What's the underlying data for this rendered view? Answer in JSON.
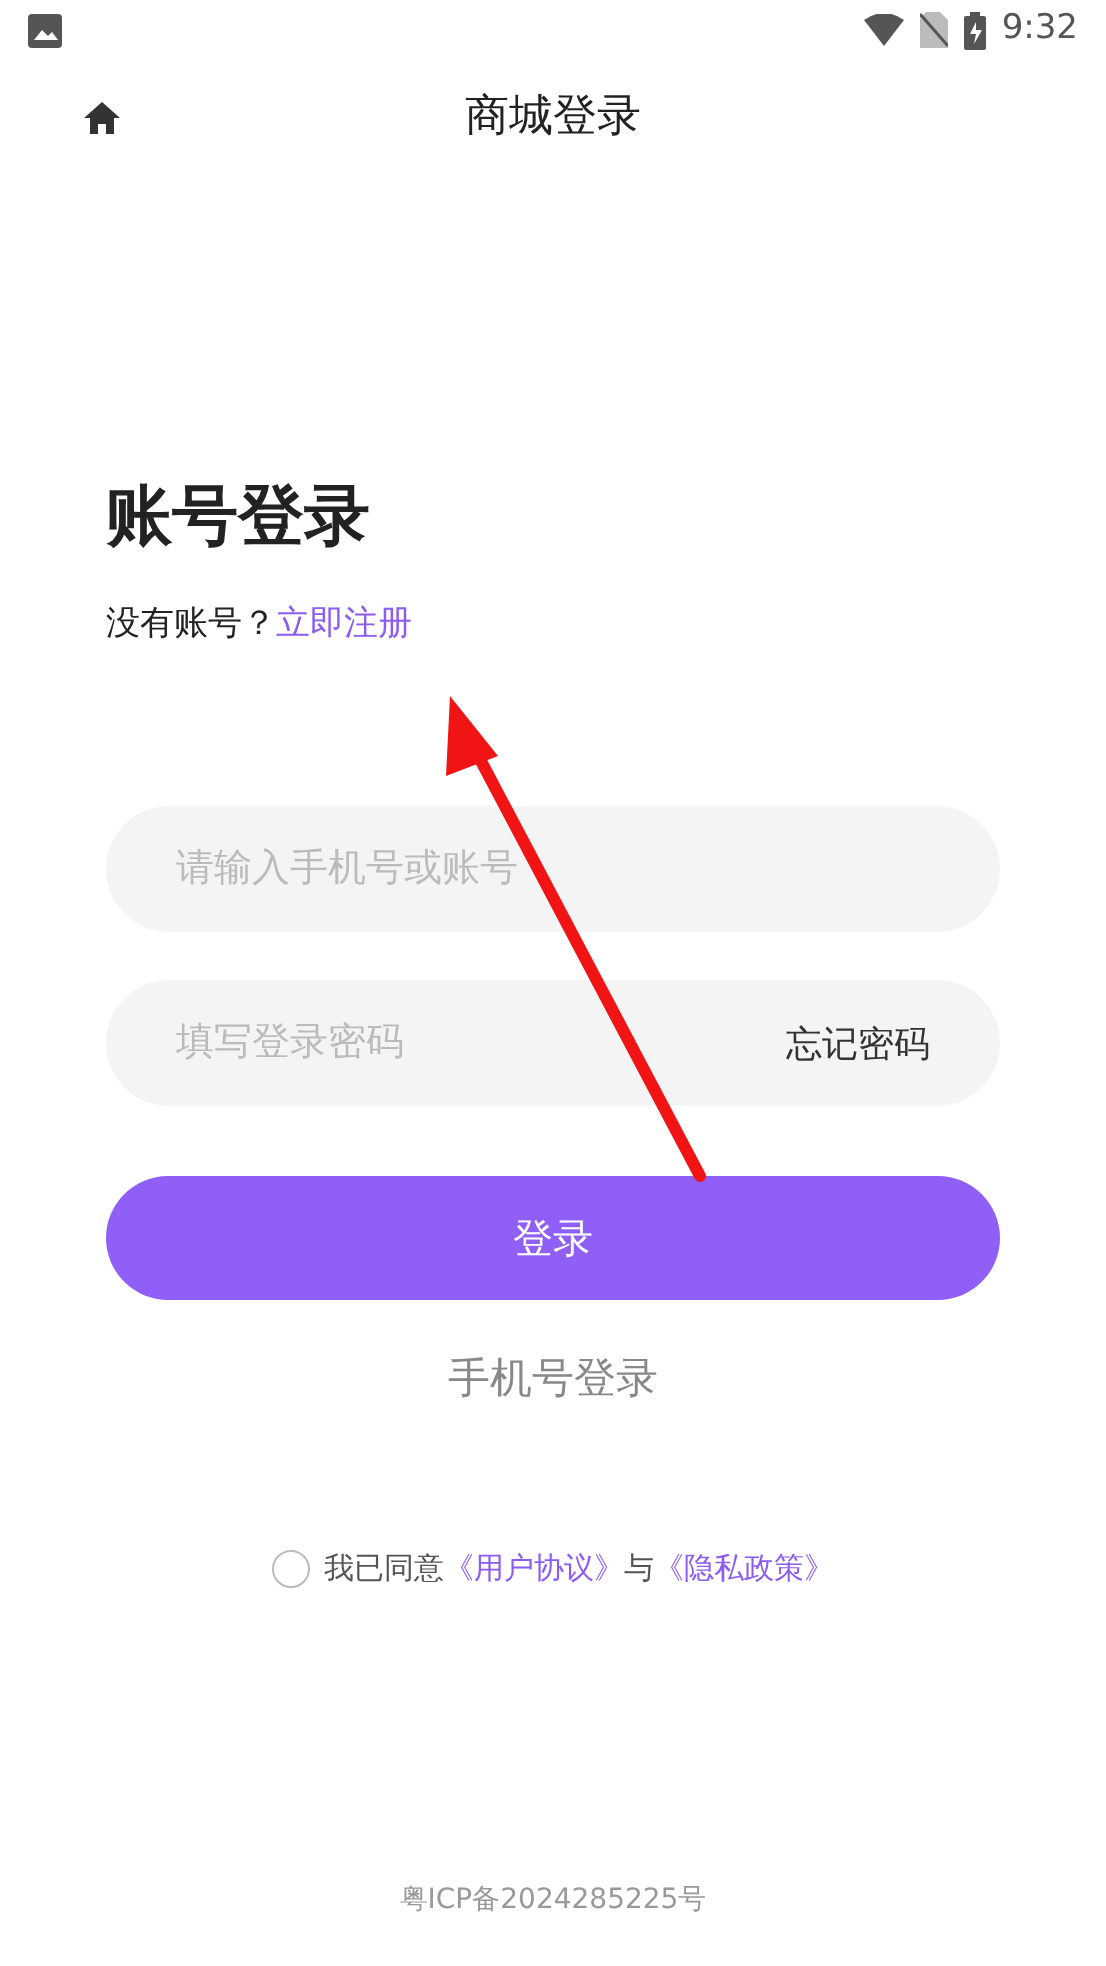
{
  "status_bar": {
    "time": "9:32"
  },
  "header": {
    "title": "商城登录"
  },
  "heading": "账号登录",
  "register": {
    "prompt": "没有账号？",
    "link": "立即注册"
  },
  "fields": [
    {
      "placeholder": "请输入手机号或账号"
    },
    {
      "placeholder": "填写登录密码",
      "action": "忘记密码"
    }
  ],
  "login_button": "登录",
  "phone_login": "手机号登录",
  "agreement": {
    "checked": false,
    "text": "我已同意",
    "link_1": "《用户协议》",
    "joiner": "与",
    "link_2": "《隐私政策》"
  },
  "footer": "粤ICP备2024285225号"
}
